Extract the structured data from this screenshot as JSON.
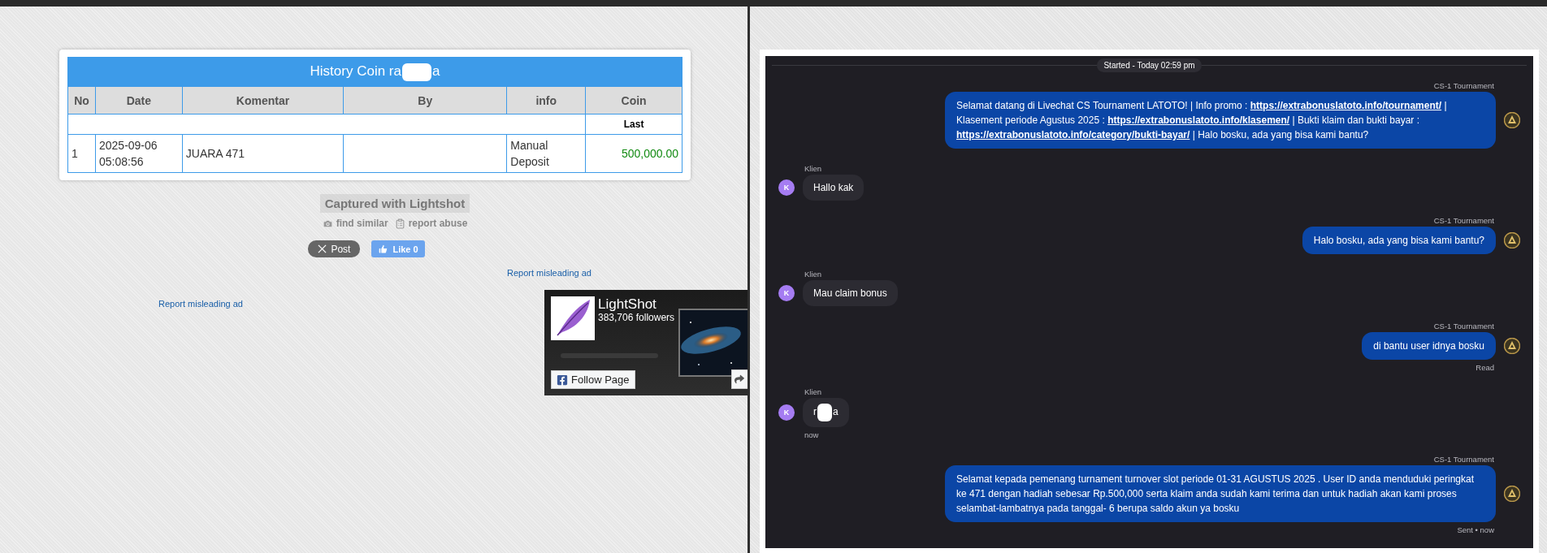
{
  "left": {
    "history_table": {
      "title": [
        {
          "kind": "text",
          "text": "History Coin ra"
        },
        {
          "kind": "redacted"
        },
        {
          "kind": "text",
          "text": "a"
        }
      ],
      "columns": [
        "No",
        "Date",
        "Komentar",
        "By",
        "info",
        "Coin"
      ],
      "summary_label": "Last",
      "rows": [
        {
          "no": "1",
          "date": "2025-09-06 05:08:56",
          "komentar": "JUARA 471",
          "info": "Manual Deposit",
          "coin": "500,000.00"
        }
      ]
    },
    "caption": "Captured with Lightshot",
    "actions": [
      {
        "kind": "camera",
        "label": "find similar"
      },
      {
        "kind": "clipboard",
        "label": "report abuse"
      }
    ],
    "share_buttons": [
      {
        "kind": "x",
        "label": "Post"
      },
      {
        "kind": "like",
        "label": "Like 0"
      }
    ],
    "ad_links": [
      "Report misleading ad",
      "Report misleading ad"
    ],
    "facebook_widget": {
      "page_name": "LightShot",
      "followers": "383,706 followers",
      "follow_button": "Follow Page"
    }
  },
  "chat": {
    "started": "Started - Today 02:59 pm",
    "messages": [
      {
        "kind": "agent",
        "sender": "CS-1 Tournament",
        "segments": [
          {
            "kind": "text",
            "text": "Selamat datang di Livechat CS Tournament LATOTO! | Info promo : "
          },
          {
            "kind": "link",
            "text": "https://extrabonuslatoto.info/tournament/"
          },
          {
            "kind": "text",
            "text": " | Klasement periode Agustus 2025 : "
          },
          {
            "kind": "link",
            "text": "https://extrabonuslatoto.info/klasemen/"
          },
          {
            "kind": "text",
            "text": " | Bukti klaim dan bukti bayar : "
          },
          {
            "kind": "link",
            "text": "https://extrabonuslatoto.info/category/bukti-bayar/"
          },
          {
            "kind": "text",
            "text": " | Halo bosku, ada yang bisa kami bantu?"
          }
        ]
      },
      {
        "kind": "client",
        "sender": "Klien",
        "initial": "K",
        "segments": [
          {
            "kind": "text",
            "text": "Hallo kak"
          }
        ]
      },
      {
        "kind": "agent",
        "sender": "CS-1 Tournament",
        "segments": [
          {
            "kind": "text",
            "text": "Halo bosku, ada yang bisa kami bantu?"
          }
        ]
      },
      {
        "kind": "client",
        "sender": "Klien",
        "initial": "K",
        "segments": [
          {
            "kind": "text",
            "text": "Mau claim bonus"
          }
        ]
      },
      {
        "kind": "agent",
        "sender": "CS-1 Tournament",
        "segments": [
          {
            "kind": "text",
            "text": "di bantu user idnya bosku"
          }
        ],
        "status": "Read"
      },
      {
        "kind": "client",
        "sender": "Klien",
        "initial": "K",
        "segments": [
          {
            "kind": "text",
            "text": "r"
          },
          {
            "kind": "redacted"
          },
          {
            "kind": "text",
            "text": "a"
          }
        ],
        "time": "now"
      },
      {
        "kind": "agent",
        "sender": "CS-1 Tournament",
        "segments": [
          {
            "kind": "text",
            "text": "Selamat kepada pemenang turnament turnover slot periode 01-31 AGUSTUS 2025 . User ID anda menduduki peringkat ke 471 dengan hadiah sebesar Rp.500,000 serta klaim anda sudah kami terima dan untuk hadiah akan kami proses selambat-lambatnya pada tanggal- 6 berupa saldo akun ya bosku"
          }
        ],
        "status": "Sent • now"
      }
    ]
  }
}
